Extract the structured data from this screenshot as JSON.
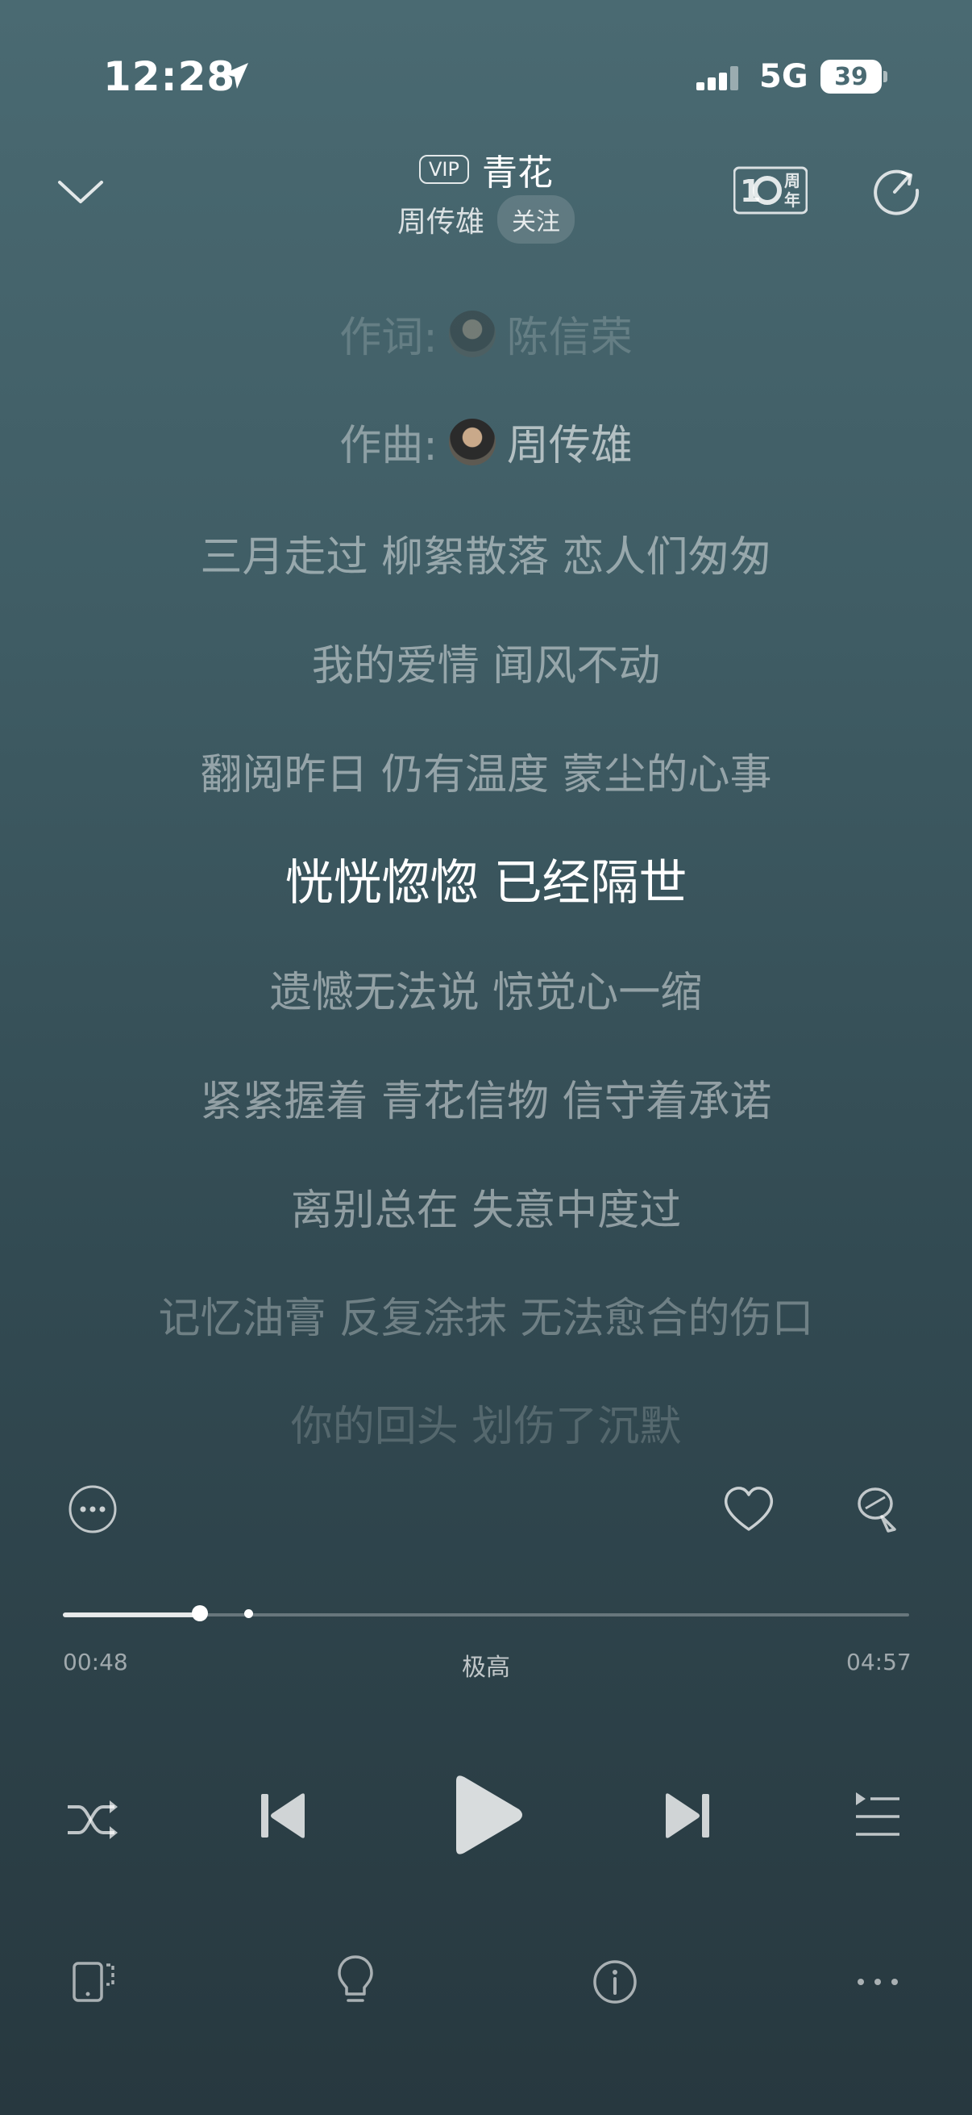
{
  "status_bar": {
    "time": "12:28",
    "network": "5G",
    "battery": "39"
  },
  "header": {
    "vip_badge": "VIP",
    "song_title": "青花",
    "artist": "周传雄",
    "follow_label": "关注",
    "anniversary_badge_text": "周年"
  },
  "lyrics": {
    "lyricist_label": "作词:",
    "lyricist": "陈信荣",
    "composer_label": "作曲:",
    "composer": "周传雄",
    "lines": [
      "三月走过 柳絮散落 恋人们匆匆",
      "我的爱情 闻风不动",
      "翻阅昨日 仍有温度 蒙尘的心事",
      "恍恍惚惚 已经隔世",
      "遗憾无法说 惊觉心一缩",
      "紧紧握着 青花信物 信守着承诺",
      "离别总在 失意中度过",
      "记忆油膏 反复涂抹 无法愈合的伤口",
      "你的回头 划伤了沉默"
    ],
    "current_line_index": 3
  },
  "player": {
    "elapsed": "00:48",
    "duration": "04:57",
    "progress": 0.162,
    "buffered": 0.219,
    "quality": "极高"
  },
  "icons": {
    "more_actions": "more-horizontal-circle-icon",
    "like": "heart-icon",
    "comment": "comment-icon",
    "shuffle": "shuffle-icon",
    "previous": "previous-icon",
    "play": "play-icon",
    "next": "next-icon",
    "playlist": "playlist-icon",
    "device": "device-icon",
    "tips": "bulb-icon",
    "info": "info-icon",
    "more": "more-icon"
  },
  "colors": {
    "background_top": "#4a6a72",
    "background_bottom": "#27383f",
    "active_lyric": "#ffffff"
  }
}
